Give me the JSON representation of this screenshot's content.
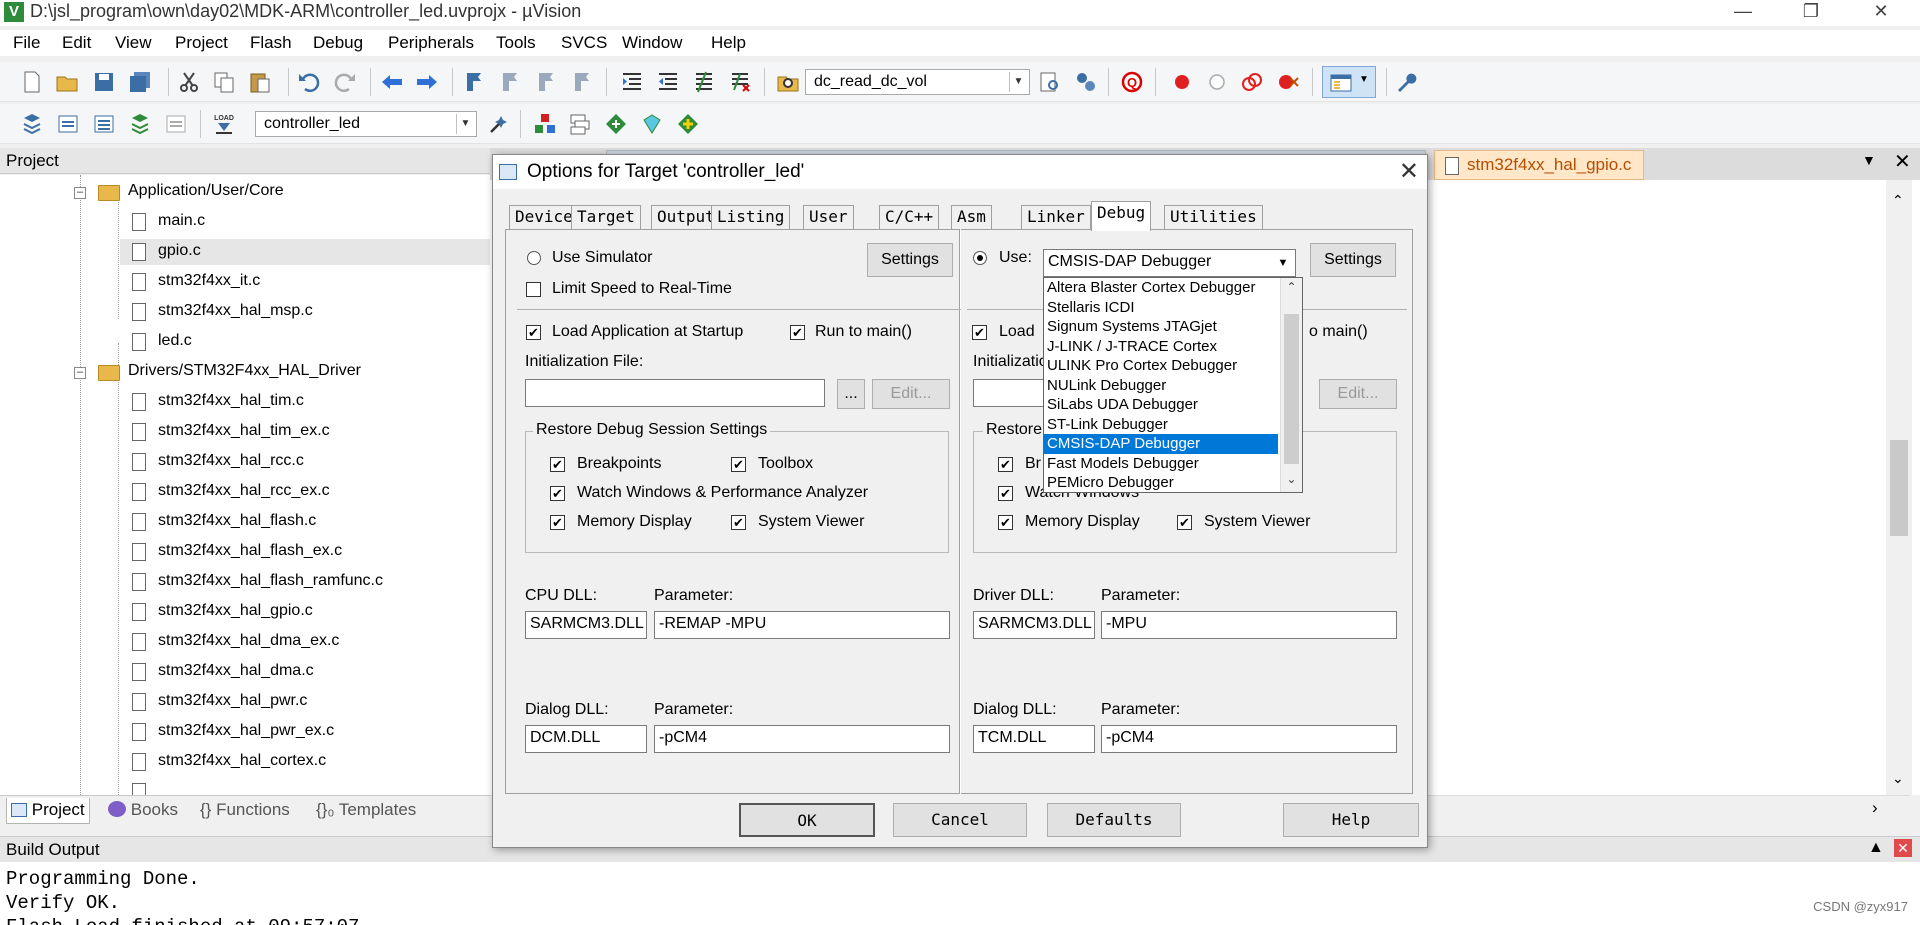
{
  "window": {
    "title": "D:\\jsl_program\\own\\day02\\MDK-ARM\\controller_led.uvprojx - µVision",
    "app_icon": "V"
  },
  "menu": [
    "File",
    "Edit",
    "View",
    "Project",
    "Flash",
    "Debug",
    "Peripherals",
    "Tools",
    "SVCS",
    "Window",
    "Help"
  ],
  "toolbar1": {
    "function_combo": "dc_read_dc_vol"
  },
  "toolbar2": {
    "target_combo": "controller_led"
  },
  "project_panel": {
    "title": "Project",
    "tree": [
      {
        "label": "Application/User/Core",
        "type": "folder"
      },
      {
        "label": "main.c",
        "type": "file"
      },
      {
        "label": "gpio.c",
        "type": "file",
        "selected": true
      },
      {
        "label": "stm32f4xx_it.c",
        "type": "file"
      },
      {
        "label": "stm32f4xx_hal_msp.c",
        "type": "file"
      },
      {
        "label": "led.c",
        "type": "file"
      },
      {
        "label": "Drivers/STM32F4xx_HAL_Driver",
        "type": "folder"
      },
      {
        "label": "stm32f4xx_hal_tim.c",
        "type": "file"
      },
      {
        "label": "stm32f4xx_hal_tim_ex.c",
        "type": "file"
      },
      {
        "label": "stm32f4xx_hal_rcc.c",
        "type": "file"
      },
      {
        "label": "stm32f4xx_hal_rcc_ex.c",
        "type": "file"
      },
      {
        "label": "stm32f4xx_hal_flash.c",
        "type": "file"
      },
      {
        "label": "stm32f4xx_hal_flash_ex.c",
        "type": "file"
      },
      {
        "label": "stm32f4xx_hal_flash_ramfunc.c",
        "type": "file"
      },
      {
        "label": "stm32f4xx_hal_gpio.c",
        "type": "file"
      },
      {
        "label": "stm32f4xx_hal_dma_ex.c",
        "type": "file"
      },
      {
        "label": "stm32f4xx_hal_dma.c",
        "type": "file"
      },
      {
        "label": "stm32f4xx_hal_pwr.c",
        "type": "file"
      },
      {
        "label": "stm32f4xx_hal_pwr_ex.c",
        "type": "file"
      },
      {
        "label": "stm32f4xx_hal_cortex.c",
        "type": "file"
      }
    ],
    "tabs": [
      {
        "label": "Project",
        "icon": "project-icon"
      },
      {
        "label": "Books",
        "icon": "books-icon"
      },
      {
        "label": "{} Functions",
        "icon": "functions-icon"
      },
      {
        "label": "{}₀ Templates",
        "icon": "templates-icon"
      }
    ]
  },
  "editor": {
    "active_tab": "stm32f4xx_hal_gpio.c"
  },
  "build_output": {
    "title": "Build Output",
    "lines": [
      "Programming Done.",
      "Verify OK.",
      "Flash Load finished at 09:57:07"
    ],
    "watermark": "CSDN @zyx917"
  },
  "dialog": {
    "title": "Options for Target 'controller_led'",
    "tabs": [
      "Device",
      "Target",
      "Output",
      "Listing",
      "User",
      "C/C++",
      "Asm",
      "Linker",
      "Debug",
      "Utilities"
    ],
    "active_tab": "Debug",
    "left": {
      "use_simulator": "Use Simulator",
      "settings": "Settings",
      "limit_speed": "Limit Speed to Real-Time",
      "load_app": "Load Application at Startup",
      "run_to_main": "Run to main()",
      "init_file_label": "Initialization File:",
      "browse": "...",
      "edit": "Edit...",
      "restore_group": "Restore Debug Session Settings",
      "breakpoints": "Breakpoints",
      "toolbox": "Toolbox",
      "watch_windows": "Watch Windows & Performance Analyzer",
      "memory_display": "Memory Display",
      "system_viewer": "System Viewer",
      "cpu_dll_label": "CPU DLL:",
      "cpu_param_label": "Parameter:",
      "cpu_dll": "SARMCM3.DLL",
      "cpu_param": "-REMAP -MPU",
      "dialog_dll_label": "Dialog DLL:",
      "dialog_param_label": "Parameter:",
      "dialog_dll": "DCM.DLL",
      "dialog_param": "-pCM4"
    },
    "right": {
      "use": "Use:",
      "debugger": "CMSIS-DAP Debugger",
      "settings": "Settings",
      "load_app": "Load",
      "run_to_main": "o main()",
      "init_file_label": "Initializatio",
      "edit": "Edit...",
      "restore_group": "Restore",
      "breakpoints": "Br",
      "watch_windows": "Watch Windows",
      "memory_display": "Memory Display",
      "system_viewer": "System Viewer",
      "driver_dll_label": "Driver DLL:",
      "driver_param_label": "Parameter:",
      "driver_dll": "SARMCM3.DLL",
      "driver_param": "-MPU",
      "dialog_dll_label": "Dialog DLL:",
      "dialog_param_label": "Parameter:",
      "dialog_dll": "TCM.DLL",
      "dialog_param": "-pCM4"
    },
    "debugger_options": [
      "Altera Blaster Cortex Debugger",
      "Stellaris ICDI",
      "Signum Systems JTAGjet",
      "J-LINK / J-TRACE Cortex",
      "ULINK Pro Cortex Debugger",
      "NULink Debugger",
      "SiLabs UDA Debugger",
      "ST-Link Debugger",
      "CMSIS-DAP Debugger",
      "Fast Models Debugger",
      "PEMicro Debugger"
    ],
    "buttons": {
      "ok": "OK",
      "cancel": "Cancel",
      "defaults": "Defaults",
      "help": "Help"
    }
  }
}
